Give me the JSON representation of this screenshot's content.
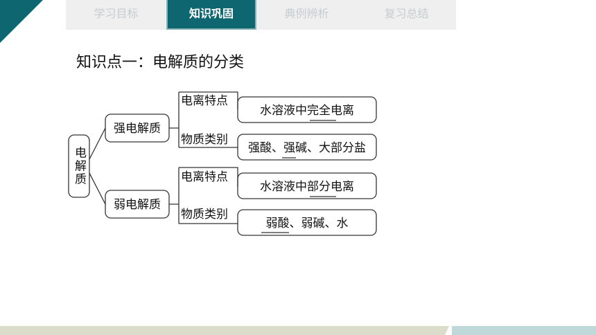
{
  "nav": {
    "tabs": [
      {
        "label": "学习目标",
        "active": false
      },
      {
        "label": "知识巩固",
        "active": true
      },
      {
        "label": "典例辨析",
        "active": false
      },
      {
        "label": "复习总结",
        "active": false
      }
    ]
  },
  "heading": "知识点一：电解质的分类",
  "diagram": {
    "root": "电解质",
    "strong": {
      "label": "强电解质",
      "ionization_label": "电离特点",
      "ionization_value": "水溶液中完全电离",
      "category_label": "物质类别",
      "category_value": "强酸、强碱、大部分盐"
    },
    "weak": {
      "label": "弱电解质",
      "ionization_label": "电离特点",
      "ionization_value": "水溶液中部分电离",
      "category_label": "物质类别",
      "category_value": "弱酸、弱碱、水"
    }
  },
  "colors": {
    "accent": "#0e6670",
    "tab_inactive_text": "#c6cccf",
    "nav_bg": "#efefef"
  }
}
